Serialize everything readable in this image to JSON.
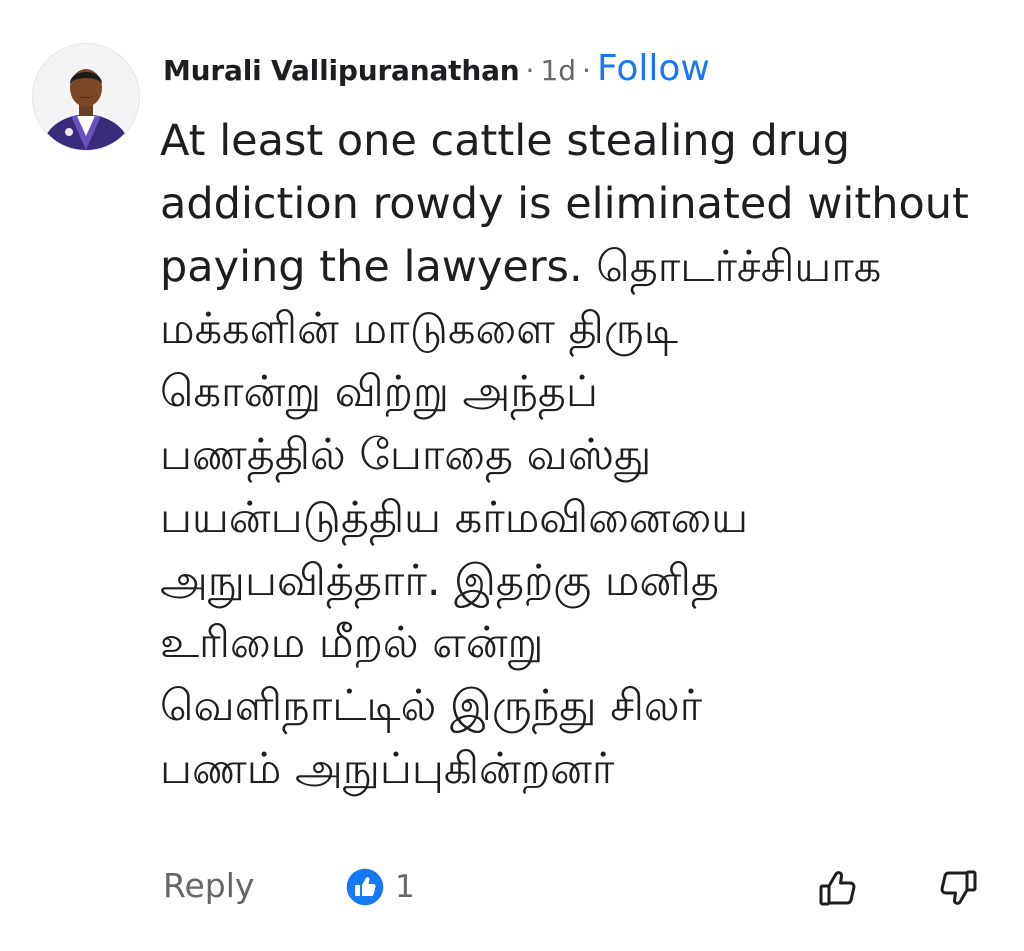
{
  "comment": {
    "author": "Murali Vallipuranathan",
    "separator": "·",
    "time": "1d",
    "follow_label": "Follow",
    "body": "At least one cattle stealing drug\naddiction rowdy is eliminated without\npaying the lawyers. தொடர்ச்சியாக\nமக்களின் மாடுகளை திருடி\nகொன்று விற்று அந்தப்\nபணத்தில் போதை வஸ்து\nபயன்படுத்திய கர்மவினையை\nஅநுபவித்தார். இதற்கு மனித\nஉரிமை மீறல் என்று\nவெளிநாட்டில் இருந்து சிலர்\nபணம் அநுப்புகின்றனர்"
  },
  "footer": {
    "reply_label": "Reply",
    "reaction_icon": "like-badge-icon",
    "reaction_count": "1",
    "upvote_icon": "thumbs-up-outline-icon",
    "downvote_icon": "thumbs-down-outline-icon"
  },
  "colors": {
    "accent": "#1877f2",
    "text": "#1c1e21",
    "muted": "#65676b"
  }
}
